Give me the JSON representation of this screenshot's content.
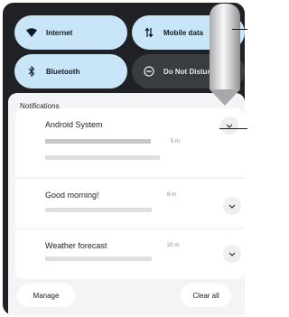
{
  "quick_tiles": {
    "internet": {
      "label": "Internet",
      "icon": "wifi-icon",
      "state": "on"
    },
    "mobile_data": {
      "label": "Mobile data",
      "icon": "mobile-data-arrows-icon",
      "state": "on"
    },
    "bluetooth": {
      "label": "Bluetooth",
      "icon": "bluetooth-icon",
      "state": "off"
    },
    "dnd": {
      "label": "Do Not Disturb",
      "icon": "do-not-disturb-icon",
      "state": "off"
    }
  },
  "notifications": {
    "header": "Notifications",
    "items": [
      {
        "title": "Android System",
        "time": "5 m",
        "icon": "expand-icon"
      },
      {
        "title": "Good morning!",
        "time": "8 m",
        "icon": "chevron-down-icon"
      },
      {
        "title": "Weather forecast",
        "time": "20 m",
        "icon": "chevron-down-icon"
      }
    ]
  },
  "actions": {
    "manage": "Manage",
    "clear_all": "Clear all"
  },
  "colors": {
    "shade_bg": "#1f2125",
    "tile_on": "#c8e6f7",
    "tile_off": "#393c41",
    "panel_bg": "#f3f4f6",
    "card_bg": "#ffffff"
  }
}
